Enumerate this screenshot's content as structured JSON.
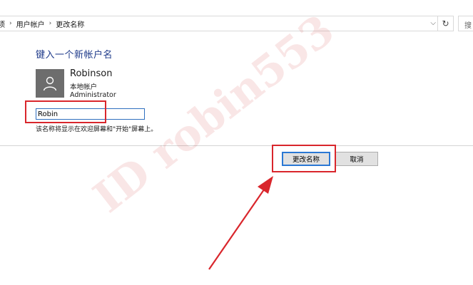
{
  "address_bar": {
    "crumbs": [
      "项",
      "用户帐户",
      "更改名称"
    ],
    "separator": "›",
    "dropdown_glyph": "⌵",
    "refresh_glyph": "↻",
    "search_placeholder": "搜"
  },
  "main": {
    "heading": "键入一个新帐户名",
    "user": {
      "name": "Robinson",
      "account_type": "本地帐户",
      "role": "Administrator"
    },
    "input_value": "Robin",
    "hint": "该名称将显示在欢迎屏幕和\"开始\"屏幕上。"
  },
  "buttons": {
    "change_name": "更改名称",
    "cancel": "取消"
  },
  "watermark": "ID robin553",
  "colors": {
    "heading": "#1e3a8a",
    "accent_border": "#2b78d4",
    "annotation_red": "#d9262c"
  }
}
